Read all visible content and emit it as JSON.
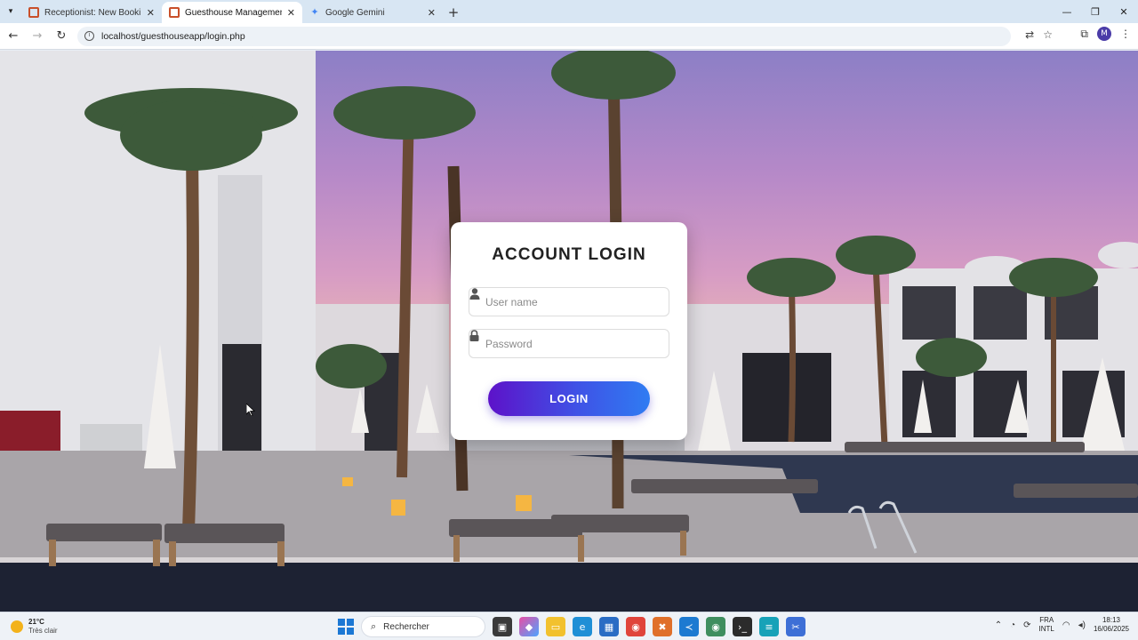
{
  "browser": {
    "tabs": [
      {
        "title": "Receptionist: New Booking - Gu",
        "favicon": "xampp-icon",
        "active": false
      },
      {
        "title": "Guesthouse Management - Login",
        "favicon": "xampp-icon",
        "active": true
      },
      {
        "title": "Google Gemini",
        "favicon": "gemini-icon",
        "active": false
      }
    ],
    "url": "localhost/guesthouseapp/login.php",
    "profile_initial": "M"
  },
  "login": {
    "title": "ACCOUNT LOGIN",
    "username_placeholder": "User name",
    "password_placeholder": "Password",
    "button_label": "LOGIN",
    "button_gradient": [
      "#5d12c9",
      "#2f7cf2"
    ]
  },
  "taskbar": {
    "weather_temp": "21°C",
    "weather_desc": "Très clair",
    "search_placeholder": "Rechercher",
    "lang_top": "FRA",
    "lang_bottom": "INTL",
    "time": "18:13",
    "date": "16/06/2025"
  }
}
